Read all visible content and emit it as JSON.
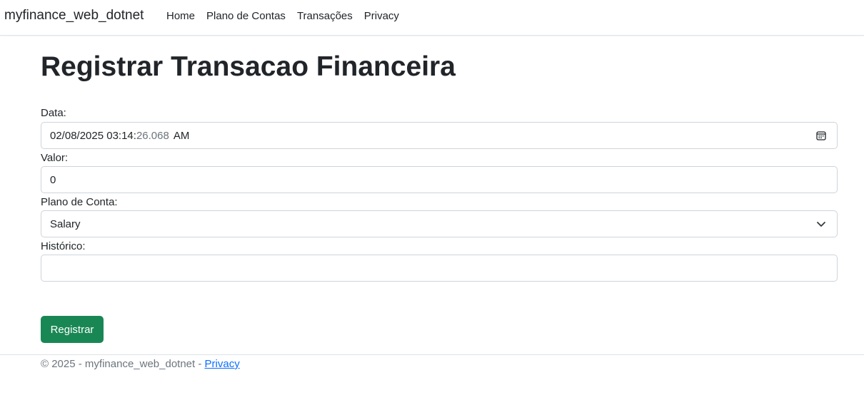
{
  "navbar": {
    "brand": "myfinance_web_dotnet",
    "links": [
      {
        "label": "Home"
      },
      {
        "label": "Plano de Contas"
      },
      {
        "label": "Transações"
      },
      {
        "label": "Privacy"
      }
    ]
  },
  "page": {
    "title": "Registrar Transacao Financeira"
  },
  "form": {
    "data": {
      "label": "Data:",
      "value_main": "02/08/2025 03:14:",
      "value_muted": "26.068",
      "value_ampm": "AM",
      "icon": "calendar-icon"
    },
    "valor": {
      "label": "Valor:",
      "value": "0"
    },
    "plano_conta": {
      "label": "Plano de Conta:",
      "selected": "Salary",
      "icon": "chevron-down-icon"
    },
    "historico": {
      "label": "Histórico:",
      "value": ""
    },
    "submit_label": "Registrar"
  },
  "footer": {
    "text": "© 2025 - myfinance_web_dotnet - ",
    "link": "Privacy"
  },
  "colors": {
    "primary_button": "#198754",
    "link": "#0d6efd",
    "muted": "#6c757d",
    "border": "#ced4da"
  }
}
